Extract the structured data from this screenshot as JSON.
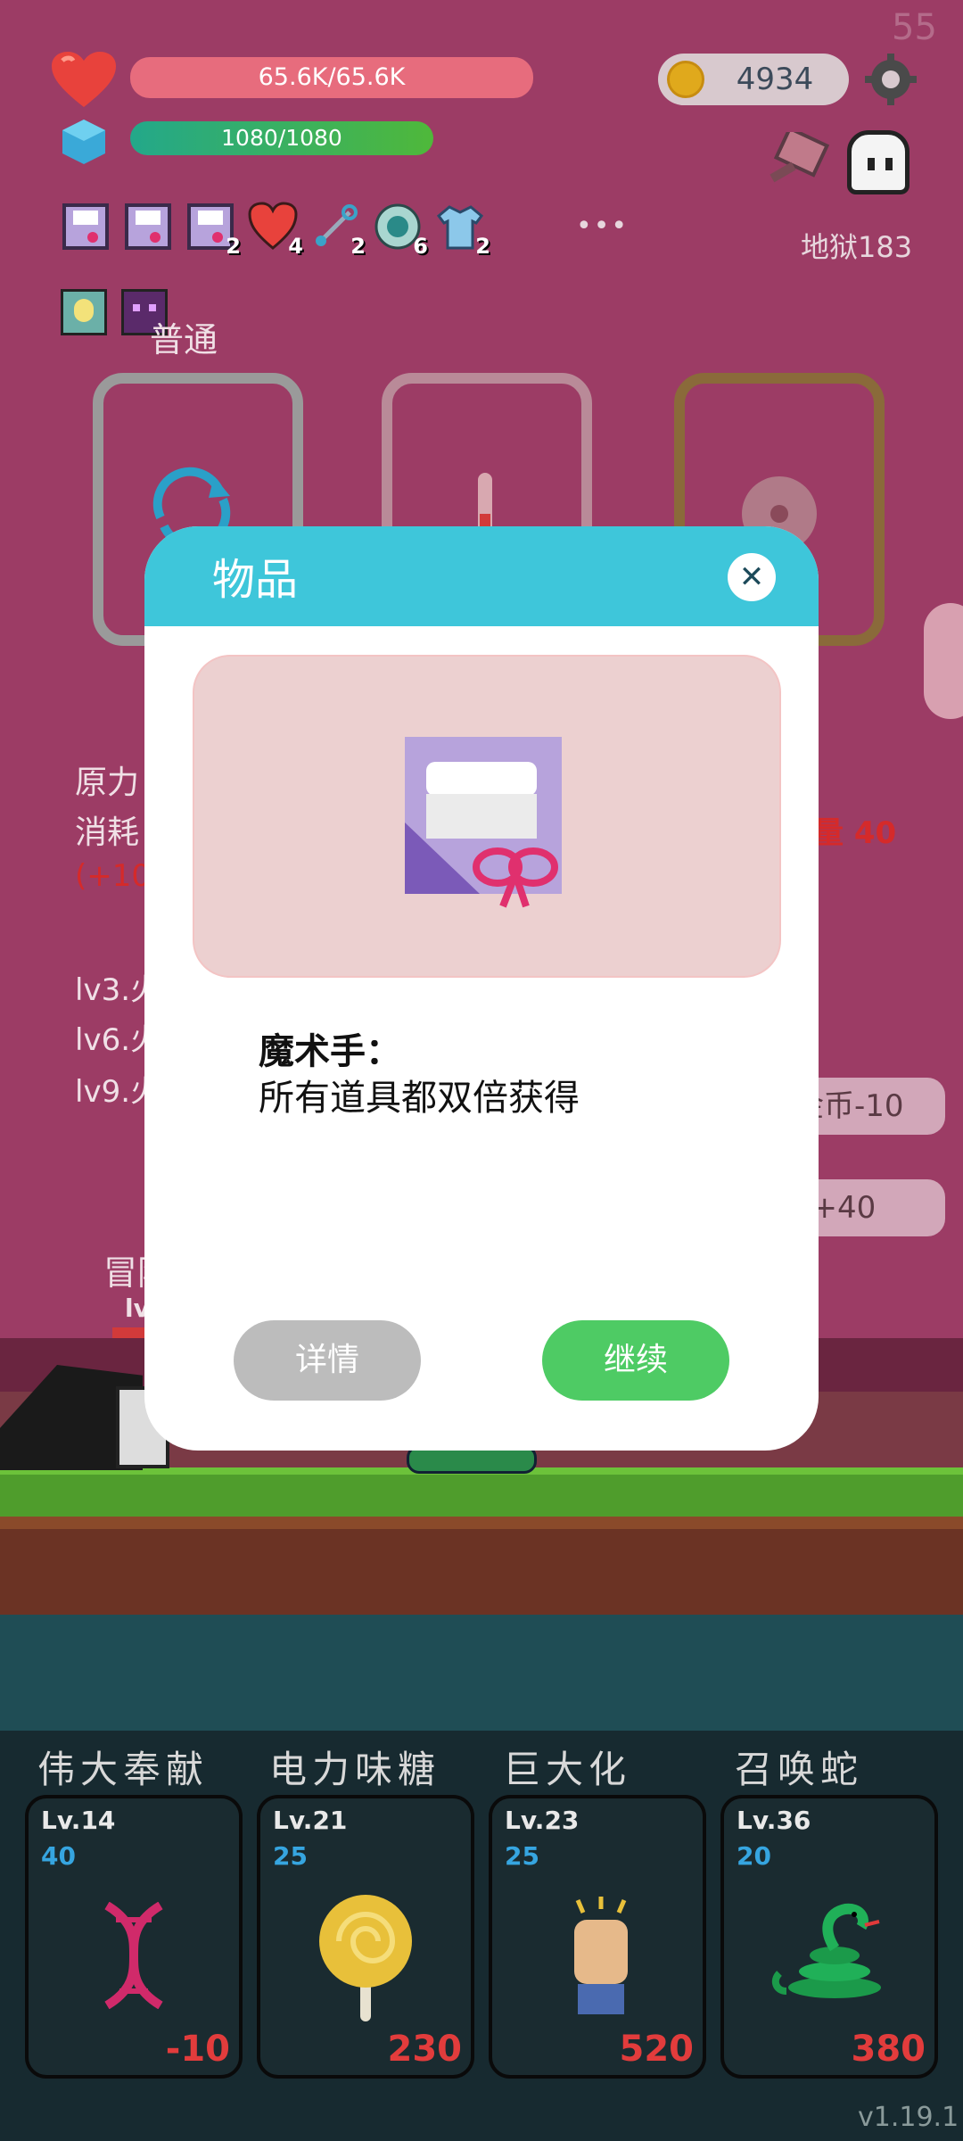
{
  "fps": "55",
  "hud": {
    "hp_text": "65.6K/65.6K",
    "mp_text": "1080/1080",
    "coins": "4934",
    "dungeon_label": "地狱183",
    "more_dots": "•••"
  },
  "items": [
    {
      "icon": "magic-hand-icon",
      "count": ""
    },
    {
      "icon": "magic-hand-icon",
      "count": ""
    },
    {
      "icon": "magic-hand-icon",
      "count": "2"
    },
    {
      "icon": "heart-icon",
      "count": "4"
    },
    {
      "icon": "safety-pin-icon",
      "count": "2"
    },
    {
      "icon": "ring-icon",
      "count": "6"
    },
    {
      "icon": "shirt-icon",
      "count": "2"
    }
  ],
  "difficulty_label": "普通",
  "background_text": {
    "line1": "原力",
    "line2": "消耗",
    "line3": "(+10",
    "bonus": "量 40",
    "lv3": "lv3.火",
    "lv6": "lv6.火",
    "lv9": "lv9.火",
    "side_btn1": "金币-10",
    "side_btn2": "P+40",
    "adventurer": "冒险",
    "adventurer_lv": "lv"
  },
  "modal": {
    "title": "物品",
    "item_name": "魔术手：",
    "item_desc": "所有道具都双倍获得",
    "details_btn": "详情",
    "continue_btn": "继续"
  },
  "skills": [
    {
      "title": "伟大奉献",
      "level": "Lv.14",
      "cost": "40",
      "price": "-10",
      "icon": "dna-icon"
    },
    {
      "title": "电力味糖",
      "level": "Lv.21",
      "cost": "25",
      "price": "230",
      "icon": "lollipop-icon"
    },
    {
      "title": "巨大化",
      "level": "Lv.23",
      "cost": "25",
      "price": "520",
      "icon": "fist-icon"
    },
    {
      "title": "召唤蛇",
      "level": "Lv.36",
      "cost": "20",
      "price": "380",
      "icon": "snake-icon"
    }
  ],
  "version": "v1.19.1"
}
